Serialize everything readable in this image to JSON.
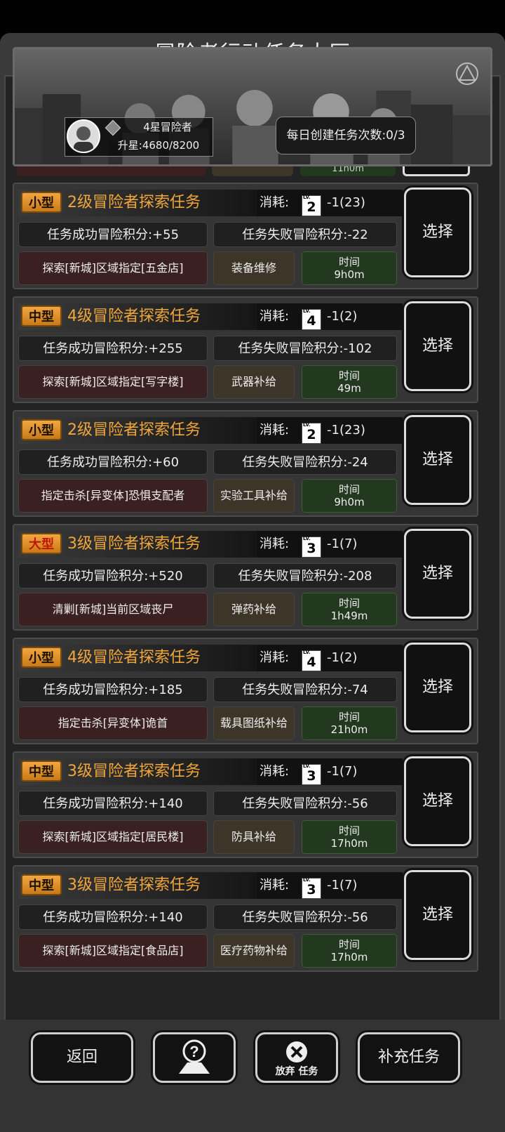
{
  "window": {
    "title": "冒险者行动任务大厅"
  },
  "profile": {
    "rank": "4星冒险者",
    "upgrade": "升星:4680/8200"
  },
  "daily": {
    "label": "每日创建任务次数:0/3"
  },
  "partial_row": {
    "time_text": "11h0m"
  },
  "missions": [
    {
      "size": "小型",
      "name": "2级冒险者探索任务",
      "cost_label": "消耗:",
      "cost_level": "2",
      "cost_value": "-1(23)",
      "success": "任务成功冒险积分:+55",
      "failure": "任务失败冒险积分:-22",
      "target": "探索[新城]区域指定[五金店]",
      "reward": "装备维修",
      "time_label": "时间",
      "time_value": "9h0m",
      "select": "选择"
    },
    {
      "size": "中型",
      "name": "4级冒险者探索任务",
      "cost_label": "消耗:",
      "cost_level": "4",
      "cost_value": "-1(2)",
      "success": "任务成功冒险积分:+255",
      "failure": "任务失败冒险积分:-102",
      "target": "探索[新城]区域指定[写字楼]",
      "reward": "武器补给",
      "time_label": "时间",
      "time_value": "49m",
      "select": "选择"
    },
    {
      "size": "小型",
      "name": "2级冒险者探索任务",
      "cost_label": "消耗:",
      "cost_level": "2",
      "cost_value": "-1(23)",
      "success": "任务成功冒险积分:+60",
      "failure": "任务失败冒险积分:-24",
      "target": "指定击杀[异变体]恐惧支配者",
      "reward": "实验工具补给",
      "time_label": "时间",
      "time_value": "9h0m",
      "select": "选择"
    },
    {
      "size": "大型",
      "name": "3级冒险者探索任务",
      "cost_label": "消耗:",
      "cost_level": "3",
      "cost_value": "-1(7)",
      "success": "任务成功冒险积分:+520",
      "failure": "任务失败冒险积分:-208",
      "target": "清剿[新城]当前区域丧尸",
      "reward": "弹药补给",
      "time_label": "时间",
      "time_value": "1h49m",
      "select": "选择"
    },
    {
      "size": "小型",
      "name": "4级冒险者探索任务",
      "cost_label": "消耗:",
      "cost_level": "4",
      "cost_value": "-1(2)",
      "success": "任务成功冒险积分:+185",
      "failure": "任务失败冒险积分:-74",
      "target": "指定击杀[异变体]诡首",
      "reward": "载具图纸补给",
      "time_label": "时间",
      "time_value": "21h0m",
      "select": "选择"
    },
    {
      "size": "中型",
      "name": "3级冒险者探索任务",
      "cost_label": "消耗:",
      "cost_level": "3",
      "cost_value": "-1(7)",
      "success": "任务成功冒险积分:+140",
      "failure": "任务失败冒险积分:-56",
      "target": "探索[新城]区域指定[居民楼]",
      "reward": "防具补给",
      "time_label": "时间",
      "time_value": "17h0m",
      "select": "选择"
    },
    {
      "size": "中型",
      "name": "3级冒险者探索任务",
      "cost_label": "消耗:",
      "cost_level": "3",
      "cost_value": "-1(7)",
      "success": "任务成功冒险积分:+140",
      "failure": "任务失败冒险积分:-56",
      "target": "探索[新城]区域指定[食品店]",
      "reward": "医疗药物补给",
      "time_label": "时间",
      "time_value": "17h0m",
      "select": "选择"
    }
  ],
  "lvl_badge_text": "LV.",
  "bottom": {
    "back": "返回",
    "abandon_line1": "放弃",
    "abandon_line2": "任务",
    "refill": "补充任务"
  },
  "colors": {
    "accent": "#f0a63a",
    "target_bg": "#3a2020",
    "reward_bg": "#3d3528",
    "time_bg": "#22381f",
    "size_badge": "#e0922e"
  },
  "icons": {
    "rank": "diamond-rank-icon",
    "help": "help-question-map-icon",
    "abandon": "close-circle-icon",
    "faction": "triangle-emblem-icon"
  }
}
